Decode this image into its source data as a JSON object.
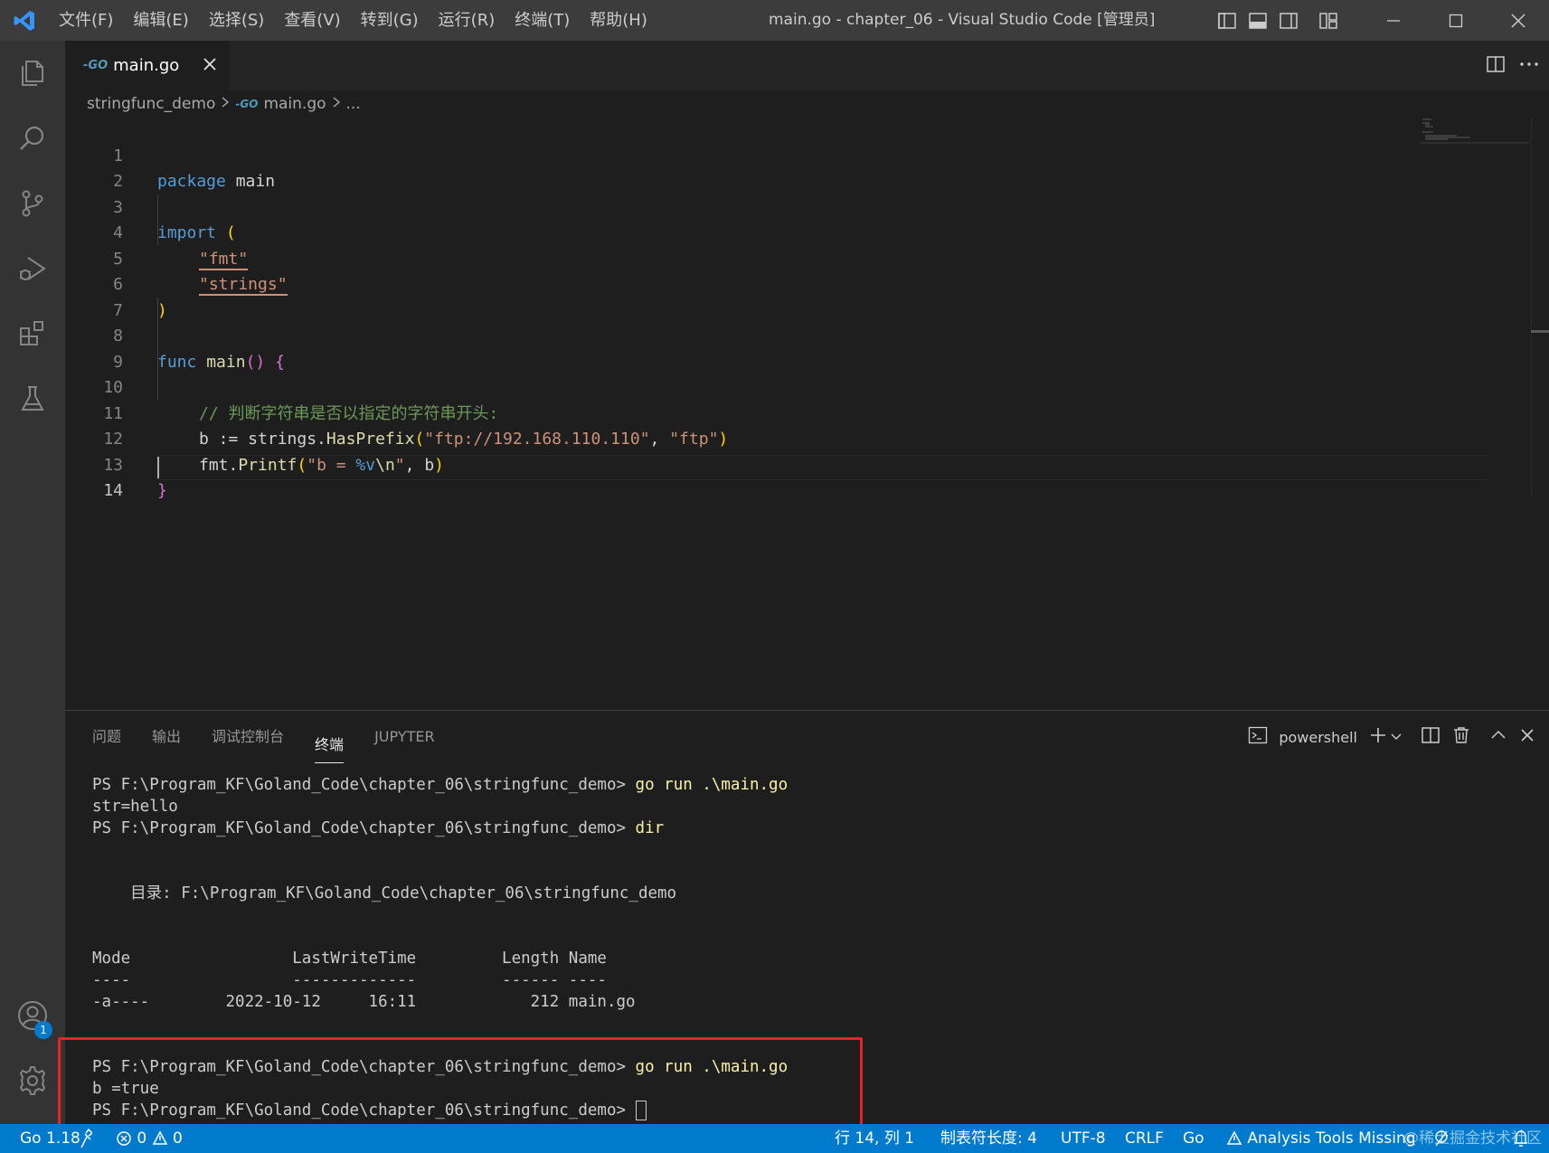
{
  "titlebar": {
    "menus": [
      "文件(F)",
      "编辑(E)",
      "选择(S)",
      "查看(V)",
      "转到(G)",
      "运行(R)",
      "终端(T)",
      "帮助(H)"
    ],
    "title": "main.go - chapter_06 - Visual Studio Code [管理员]"
  },
  "activitybar": {
    "items": [
      "explorer-icon",
      "search-icon",
      "source-control-icon",
      "run-debug-icon",
      "extensions-icon",
      "testing-icon"
    ],
    "accounts_badge": "1"
  },
  "editor": {
    "tab": {
      "label": "main.go",
      "lang_badge": "-GO"
    },
    "breadcrumb": {
      "folder": "stringfunc_demo",
      "file": "main.go",
      "more": "...",
      "lang_badge": "-GO"
    },
    "lines": [
      {
        "n": "1"
      },
      {
        "n": "2"
      },
      {
        "n": "3"
      },
      {
        "n": "4"
      },
      {
        "n": "5"
      },
      {
        "n": "6"
      },
      {
        "n": "7"
      },
      {
        "n": "8"
      },
      {
        "n": "9"
      },
      {
        "n": "10"
      },
      {
        "n": "11"
      },
      {
        "n": "12"
      },
      {
        "n": "13"
      },
      {
        "n": "14"
      }
    ],
    "code": {
      "l1_kw": "package",
      "l1_name": "main",
      "l3_kw": "import",
      "l3_paren": "(",
      "l4_str": "\"fmt\"",
      "l5_str": "\"strings\"",
      "l6_paren": ")",
      "l8_kw": "func",
      "l8_fn": "main",
      "l8_parens": "()",
      "l8_brace": "{",
      "l10_comment": "// 判断字符串是否以指定的字符串开头:",
      "l11_var": "b := strings.",
      "l11_fn": "HasPrefix",
      "l11_open": "(",
      "l11_arg1": "\"ftp://192.168.110.110\"",
      "l11_comma": ", ",
      "l11_arg2": "\"ftp\"",
      "l11_close": ")",
      "l12_pre": "fmt.",
      "l12_fn": "Printf",
      "l12_open": "(",
      "l12_str1": "\"b = ",
      "l12_fmt": "%v",
      "l12_esc": "\\n",
      "l12_str2": "\"",
      "l12_rest": ", b",
      "l12_close": ")",
      "l13_brace": "}"
    }
  },
  "panel": {
    "tabs": [
      "问题",
      "输出",
      "调试控制台",
      "终端",
      "JUPYTER"
    ],
    "active_tab": "终端",
    "terminal_name": "powershell",
    "terminal": {
      "prompt": "PS F:\\Program_KF\\Goland_Code\\chapter_06\\stringfunc_demo> ",
      "cmd1": "go run .\\main.go",
      "out1": "str=hello",
      "cmd2": "dir",
      "dir_line": "    目录: F:\\Program_KF\\Goland_Code\\chapter_06\\stringfunc_demo",
      "header": "Mode                 LastWriteTime         Length Name",
      "divider": "----                 -------------         ------ ----",
      "row": "-a----        2022-10-12     16:11            212 main.go",
      "cmd3": "go run .\\main.go",
      "out3": "b =true"
    }
  },
  "statusbar": {
    "go_version": "Go 1.18",
    "errors": "0",
    "warnings": "0",
    "position": "行 14, 列 1",
    "indent": "制表符长度: 4",
    "encoding": "UTF-8",
    "eol": "CRLF",
    "language": "Go",
    "analysis": "Analysis Tools Missing",
    "watermark": "@稀土掘金技术社区"
  },
  "colors": {
    "accent": "#007acc",
    "highlight_box": "#e82323"
  }
}
